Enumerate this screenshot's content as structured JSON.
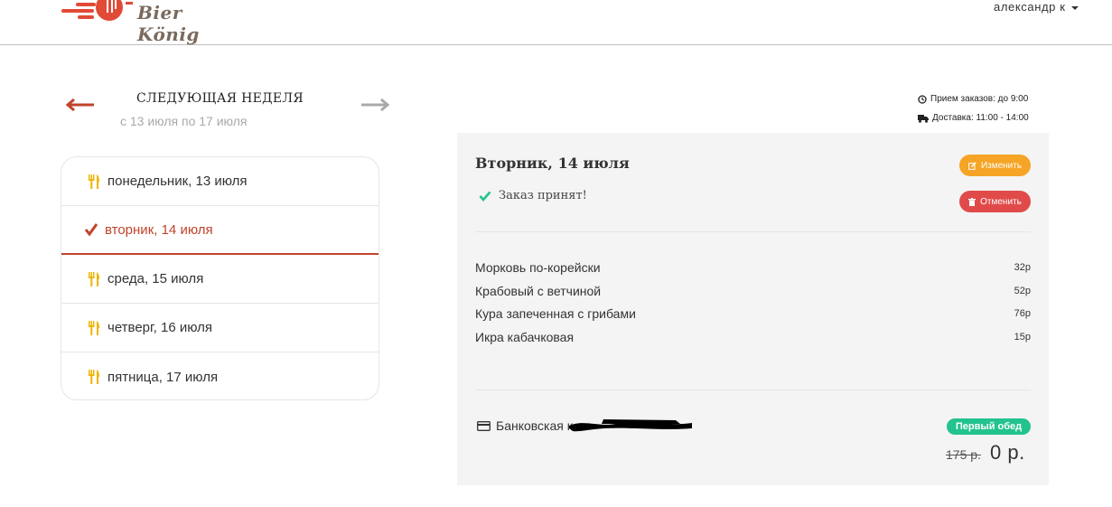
{
  "header": {
    "logo_text": "Bier König",
    "user_name": "александр к"
  },
  "week": {
    "title": "СЛЕДУЮЩАЯ НЕДЕЛЯ",
    "range": "с 13 июля по 17 июля"
  },
  "days": [
    {
      "label": "понедельник, 13 июля",
      "icon": "utensils-icon",
      "active": false
    },
    {
      "label": "вторник, 14 июля",
      "icon": "check-icon",
      "active": true
    },
    {
      "label": "среда, 15 июля",
      "icon": "utensils-icon",
      "active": false
    },
    {
      "label": "четверг, 16 июля",
      "icon": "utensils-icon",
      "active": false
    },
    {
      "label": "пятница, 17 июля",
      "icon": "utensils-icon",
      "active": false
    }
  ],
  "info": {
    "orders_until": "Прием заказов: до 9:00",
    "delivery": "Доставка: 11:00 - 14:00"
  },
  "order": {
    "title": "Вторник, 14 июля",
    "status": "Заказ принят!",
    "edit_label": "Изменить",
    "cancel_label": "Отменить",
    "items": [
      {
        "name": "Морковь по-корейски",
        "price": "32р"
      },
      {
        "name": "Крабовый с ветчиной",
        "price": "52р"
      },
      {
        "name": "Кура запеченная с грибами",
        "price": "76р"
      },
      {
        "name": "Икра кабачковая",
        "price": "15р"
      }
    ],
    "payment_label": "Банковская к",
    "badge": "Первый обед",
    "price_old": "175 р.",
    "price_new": "0 р."
  },
  "colors": {
    "accent_red": "#c0432b",
    "edit_orange": "#f5a425",
    "cancel_red": "#e04b49",
    "badge_green": "#22c38e",
    "check_green": "#22c38e",
    "utensils_yellow": "#f0b400"
  }
}
